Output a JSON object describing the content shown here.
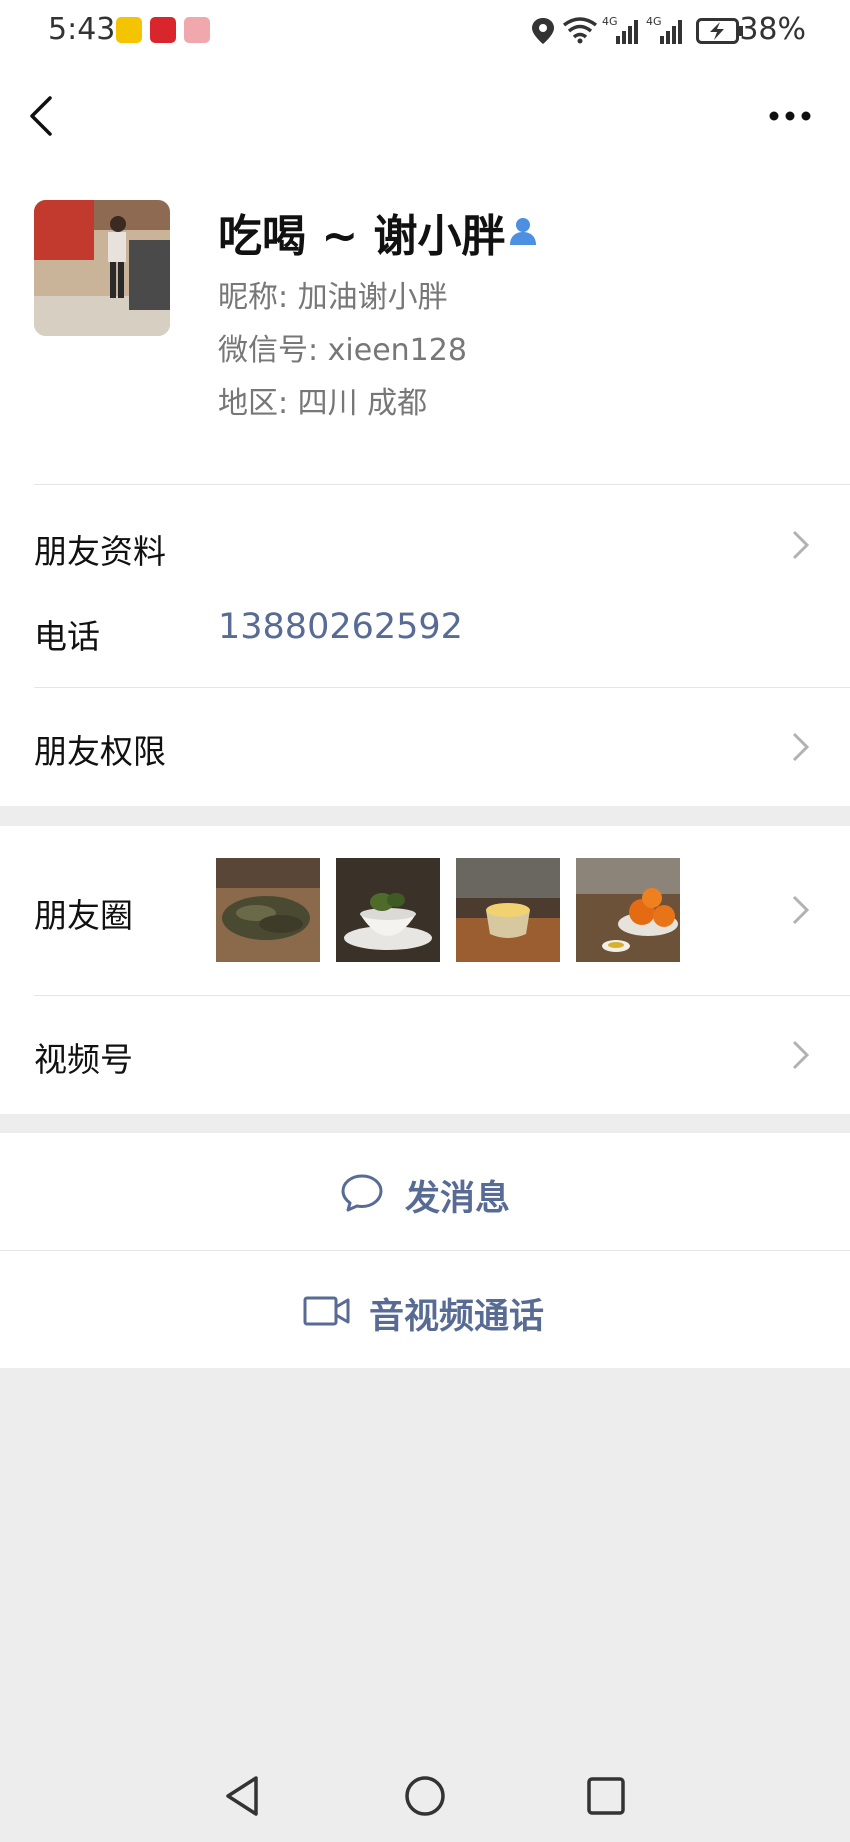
{
  "status": {
    "time": "5:43",
    "battery": "38%"
  },
  "profile": {
    "name": "吃喝 ~ 谢小胖",
    "nickname": "昵称:  加油谢小胖",
    "wechat_id": "微信号:  xieen128",
    "region": "地区:  四川  成都"
  },
  "rows": {
    "friend_profile": "朋友资料",
    "phone_label": "电话",
    "phone_value": "13880262592",
    "permissions": "朋友权限",
    "moments": "朋友圈",
    "channels": "视频号"
  },
  "actions": {
    "message": "发消息",
    "call": "音视频通话"
  },
  "colors": {
    "link": "#576b95",
    "background": "#ededed"
  }
}
